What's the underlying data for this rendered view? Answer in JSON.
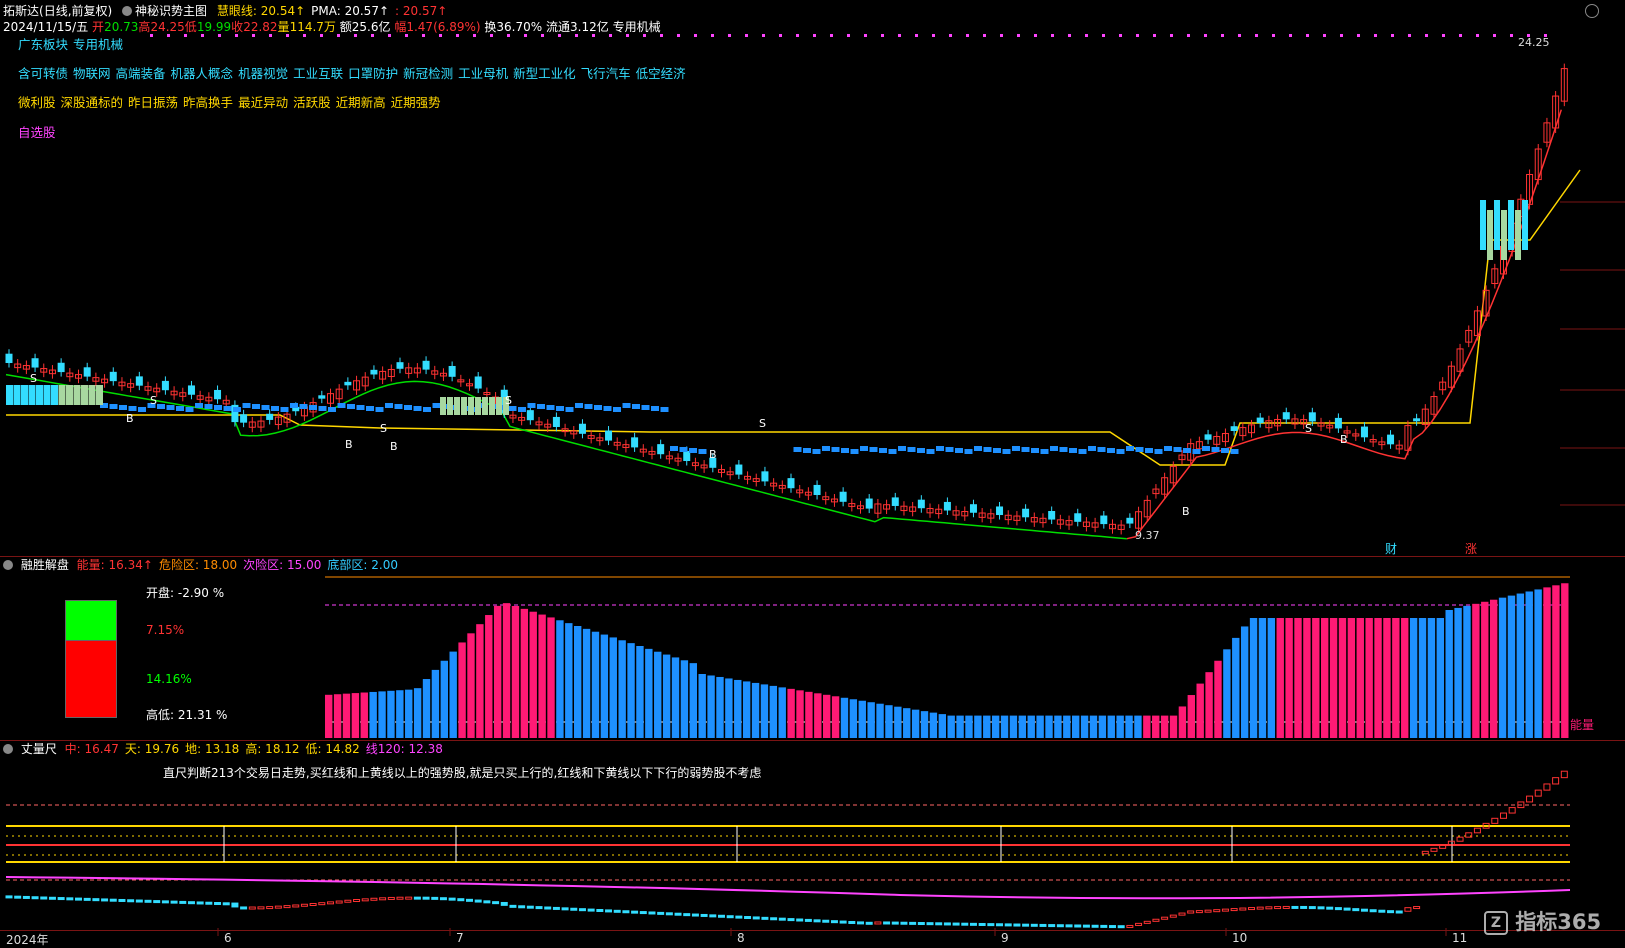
{
  "app": {
    "name": "拓斯达",
    "mode": "(日线,前复权)"
  },
  "main_indicator": {
    "name": "神秘识势主图",
    "values": [
      {
        "label": "慧眼线:",
        "value": "20.54",
        "arrow": "↑",
        "color": "#ffd700"
      },
      {
        "label": "PMA:",
        "value": "20.57",
        "arrow": "↑",
        "color": "#ffffff"
      },
      {
        "label": ":",
        "value": "20.57",
        "arrow": "↑",
        "color": "#ff3333"
      }
    ]
  },
  "quote": {
    "date": "2024/11/15/五",
    "open_label": "开",
    "open": "20.73",
    "high_label": "高",
    "high": "24.25",
    "low_label": "低",
    "low": "19.99",
    "close_label": "收",
    "close": "22.82",
    "vol_label": "量",
    "vol": "114.7万",
    "amt_label": "额",
    "amt": "25.6亿",
    "chg_label": "幅",
    "chg": "1.47(6.89%)",
    "turn_label": "换",
    "turn": "36.70%",
    "float_label": "流通",
    "float": "3.12亿",
    "industry": "专用机械"
  },
  "tags": {
    "row1": [
      "广东板块",
      "专用机械"
    ],
    "row2": [
      "含可转债",
      "物联网",
      "高端装备",
      "机器人概念",
      "机器视觉",
      "工业互联",
      "口罩防护",
      "新冠检测",
      "工业母机",
      "新型工业化",
      "飞行汽车",
      "低空经济"
    ],
    "row3": [
      "微利股",
      "深股通标的",
      "昨日振荡",
      "昨高换手",
      "最近异动",
      "活跃股",
      "近期新高",
      "近期强势"
    ],
    "row4": [
      "自选股"
    ]
  },
  "price_labels": {
    "high": "24.25",
    "low": "9.37"
  },
  "chart_markers": {
    "sell": "S",
    "buy": "B",
    "finance": "财",
    "limit_up": "涨"
  },
  "sub1": {
    "name": "融胜解盘",
    "values": [
      {
        "label": "能量:",
        "value": "16.34",
        "arrow": "↑",
        "color": "#ff3333"
      },
      {
        "label": "危险区:",
        "value": "18.00",
        "arrow": "",
        "color": "#ff8c00"
      },
      {
        "label": "次险区:",
        "value": "15.00",
        "arrow": "",
        "color": "#ff44ff"
      },
      {
        "label": "底部区:",
        "value": "2.00",
        "arrow": "",
        "color": "#33ccff"
      }
    ],
    "info": {
      "open_label": "开盘:",
      "open": "-2.90 %",
      "red": "7.15%",
      "green": "14.16%",
      "range_label": "高低:",
      "range": "21.31 %"
    },
    "energy_label": "能量"
  },
  "sub2": {
    "name": "丈量尺",
    "values": [
      {
        "label": "中:",
        "value": "16.47",
        "color": "#ff3333"
      },
      {
        "label": "天:",
        "value": "19.76",
        "color": "#ffd700"
      },
      {
        "label": "地:",
        "value": "13.18",
        "color": "#ffd700"
      },
      {
        "label": "高:",
        "value": "18.12",
        "color": "#ffd700"
      },
      {
        "label": "低:",
        "value": "14.82",
        "color": "#ffd700"
      },
      {
        "label": "线120:",
        "value": "12.38",
        "color": "#ff44ff"
      }
    ],
    "note": "直尺判断213个交易日走势,买红线和上黄线以上的强势股,就是只买上行的,红线和下黄线以下下行的弱势股不考虑"
  },
  "x_axis": [
    "2024年",
    "6",
    "7",
    "8",
    "9",
    "10",
    "11"
  ],
  "watermark": "指标365",
  "colors": {
    "up": "#ff3333",
    "down": "#33ddff",
    "yellow": "#ffd700",
    "green": "#00dd00",
    "magenta": "#ff44ff",
    "blue": "#1e90ff",
    "pink": "#ff1a75"
  }
}
